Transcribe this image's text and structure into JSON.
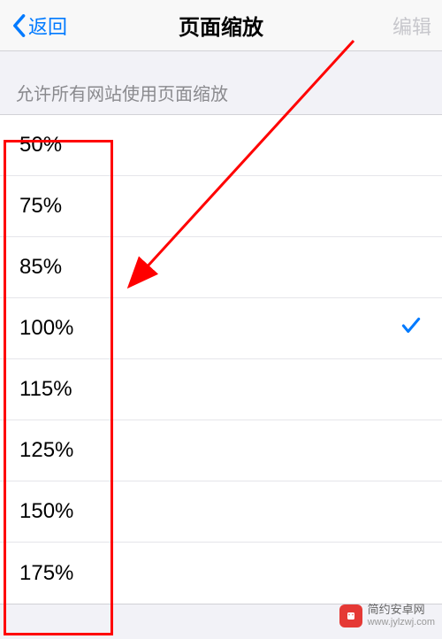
{
  "header": {
    "back_label": "返回",
    "title": "页面缩放",
    "edit_label": "编辑"
  },
  "section": {
    "header": "允许所有网站使用页面缩放"
  },
  "zoom_options": [
    {
      "label": "50%",
      "selected": false
    },
    {
      "label": "75%",
      "selected": false
    },
    {
      "label": "85%",
      "selected": false
    },
    {
      "label": "100%",
      "selected": true
    },
    {
      "label": "115%",
      "selected": false
    },
    {
      "label": "125%",
      "selected": false
    },
    {
      "label": "150%",
      "selected": false
    },
    {
      "label": "175%",
      "selected": false
    }
  ],
  "watermark": {
    "name": "简约安卓网",
    "url": "www.jylzwj.com"
  }
}
